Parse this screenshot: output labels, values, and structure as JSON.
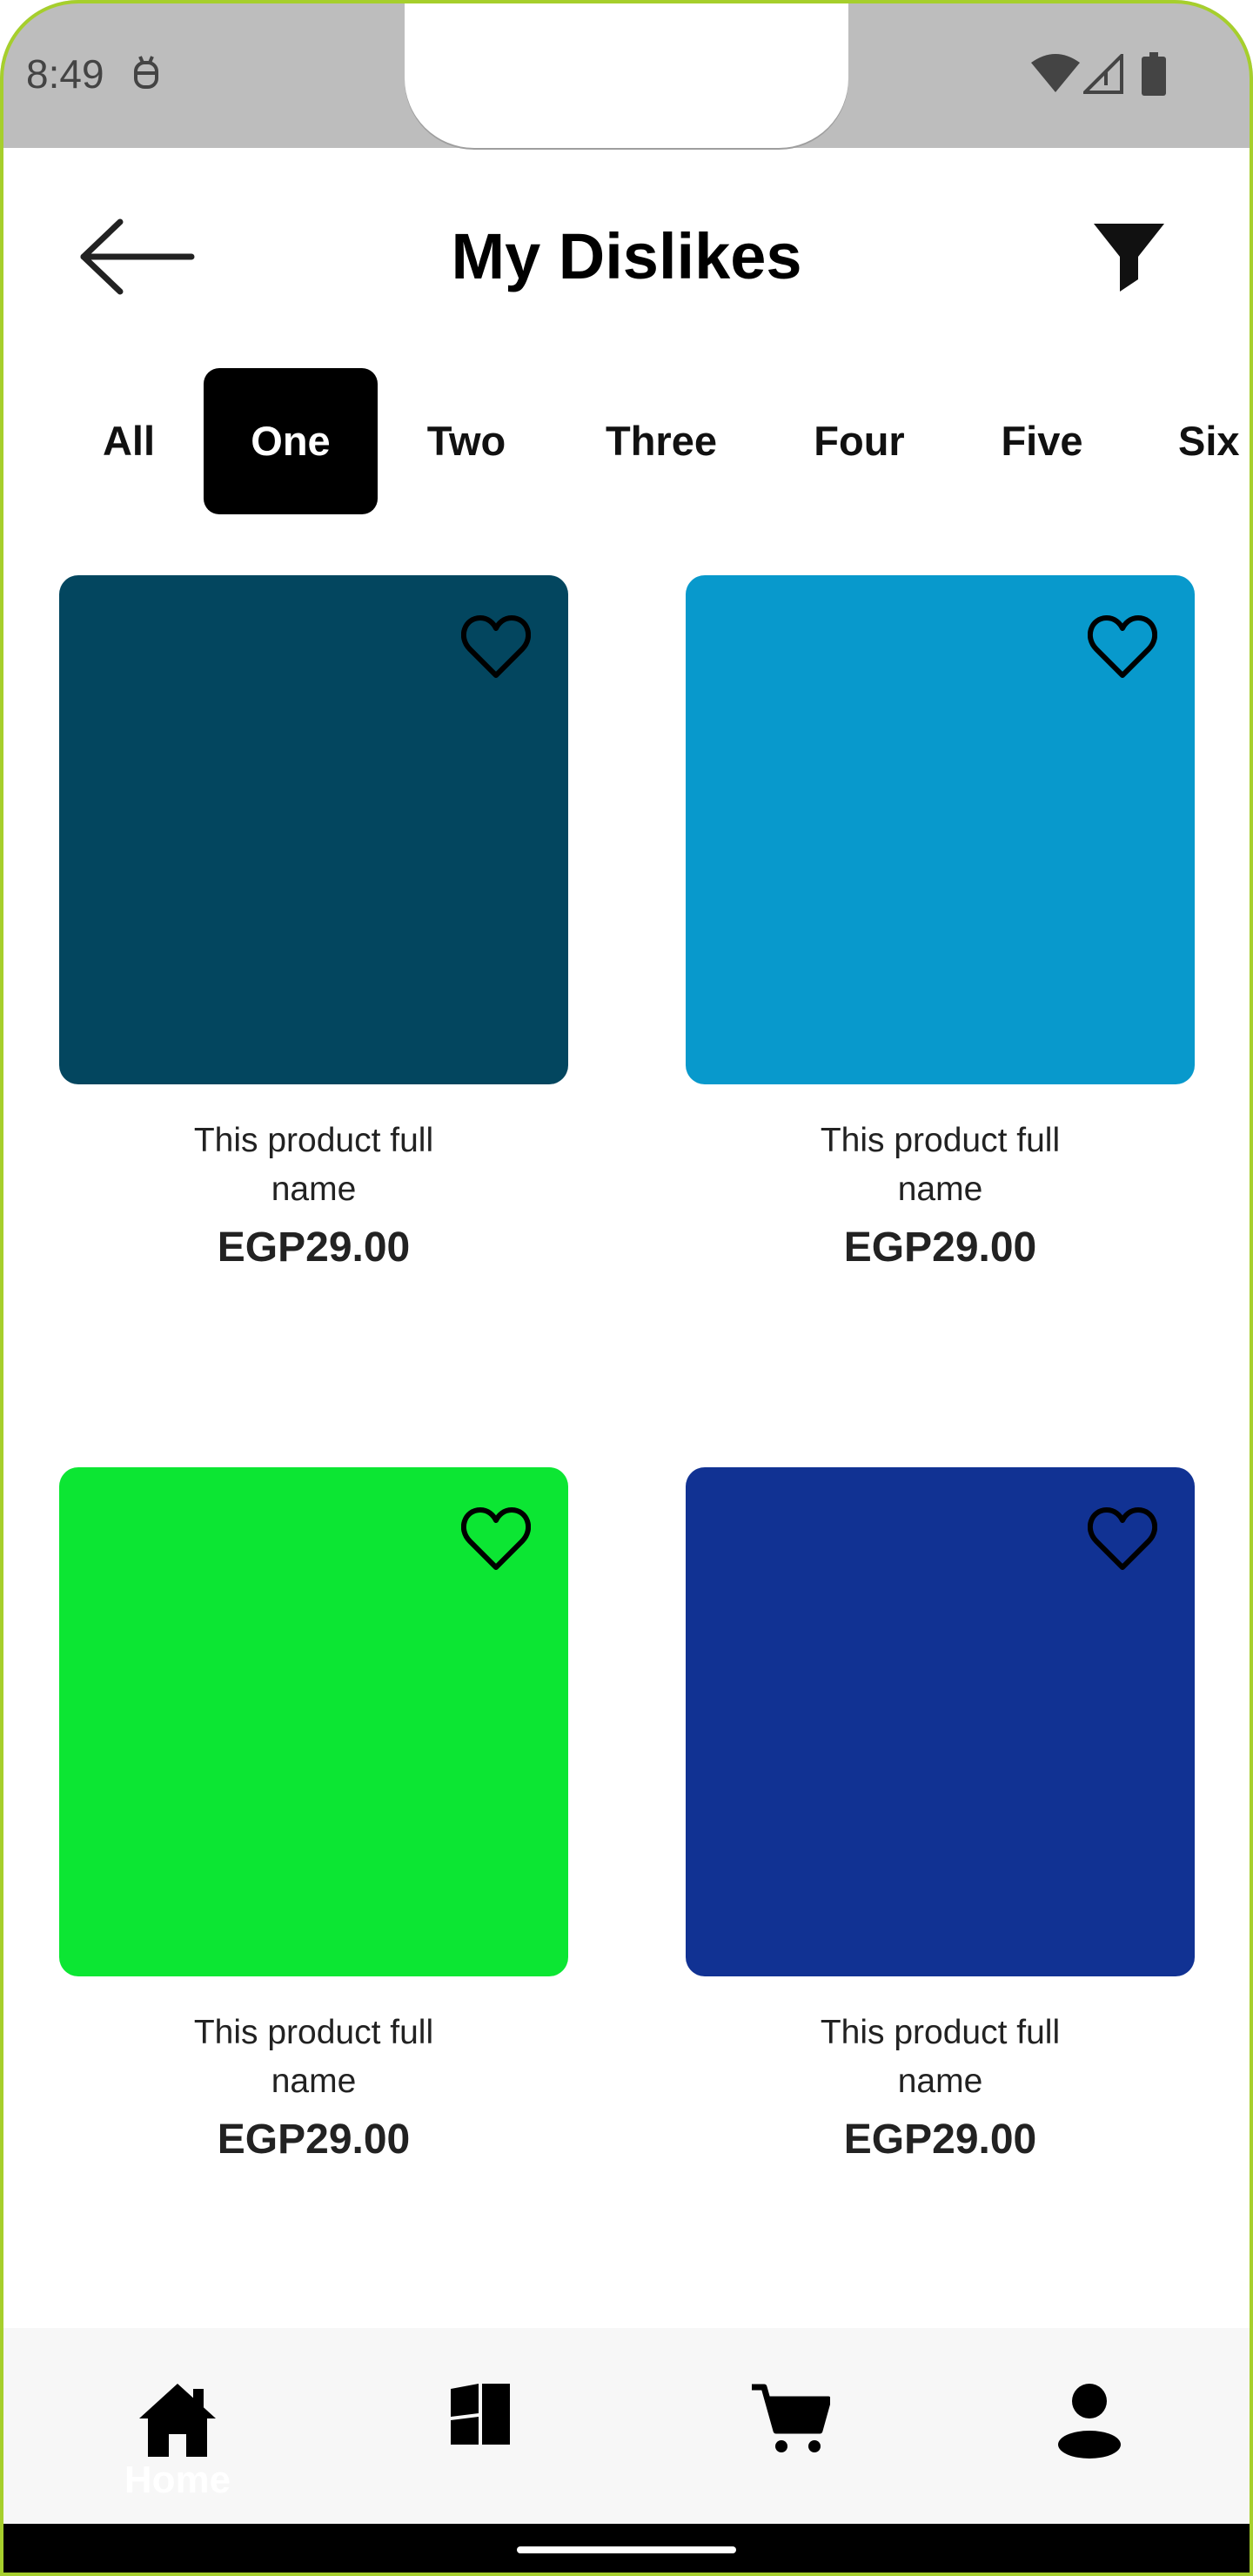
{
  "status_bar": {
    "time": "8:49"
  },
  "header": {
    "title": "My Dislikes"
  },
  "tabs": [
    {
      "label": "All",
      "active": false
    },
    {
      "label": "One",
      "active": true
    },
    {
      "label": "Two",
      "active": false
    },
    {
      "label": "Three",
      "active": false
    },
    {
      "label": "Four",
      "active": false
    },
    {
      "label": "Five",
      "active": false
    },
    {
      "label": "Six",
      "active": false
    }
  ],
  "products": [
    {
      "name_line1": "This product full",
      "name_line2": "name",
      "price": "EGP29.00",
      "color": "#03465f"
    },
    {
      "name_line1": "This product full",
      "name_line2": "name",
      "price": "EGP29.00",
      "color": "#0899cc"
    },
    {
      "name_line1": "This product full",
      "name_line2": "name",
      "price": "EGP29.00",
      "color": "#0ce633"
    },
    {
      "name_line1": "This product full",
      "name_line2": "name",
      "price": "EGP29.00",
      "color": "#113293"
    }
  ],
  "bottom_nav": {
    "items": [
      {
        "icon": "home-icon",
        "label": "Home"
      },
      {
        "icon": "categories-icon",
        "label": ""
      },
      {
        "icon": "cart-icon",
        "label": ""
      },
      {
        "icon": "profile-icon",
        "label": ""
      }
    ]
  }
}
